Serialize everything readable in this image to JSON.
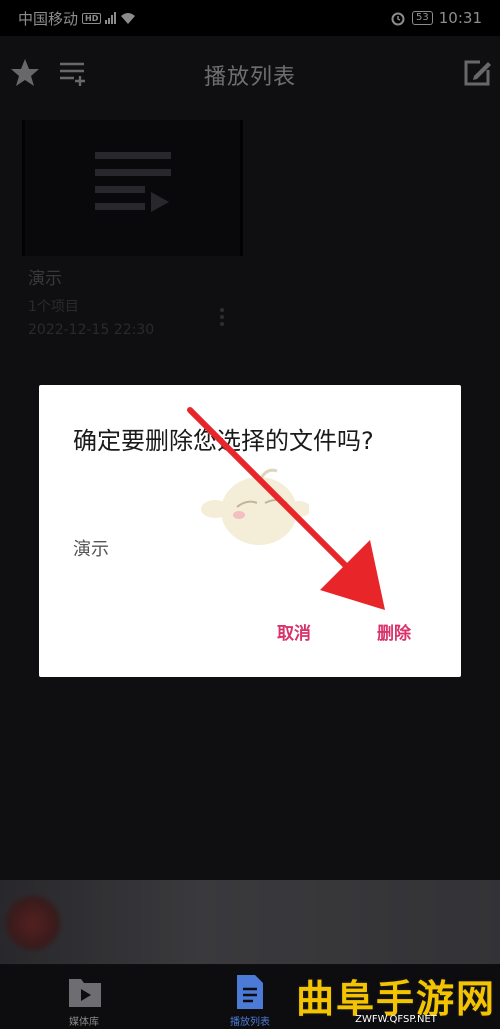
{
  "status_bar": {
    "carrier": "中国移动",
    "hd": "HD",
    "battery": "53",
    "time": "10:31"
  },
  "top_bar": {
    "title": "播放列表"
  },
  "playlist": {
    "items": [
      {
        "title": "演示",
        "count": "1个项目",
        "date": "2022-12-15 22:30"
      }
    ]
  },
  "dialog": {
    "title": "确定要删除您选择的文件吗?",
    "message": "演示",
    "cancel_label": "取消",
    "delete_label": "删除"
  },
  "bottom_nav": {
    "media_label": "媒体库",
    "playlist_label": "播放列表"
  },
  "watermark": {
    "title": "曲阜手游网",
    "url": "ZWFW.QFSP.NET"
  },
  "colors": {
    "accent": "#d8336a",
    "nav_active": "#4b7bd6",
    "arrow": "#e8262a",
    "watermark": "#f5c400"
  }
}
